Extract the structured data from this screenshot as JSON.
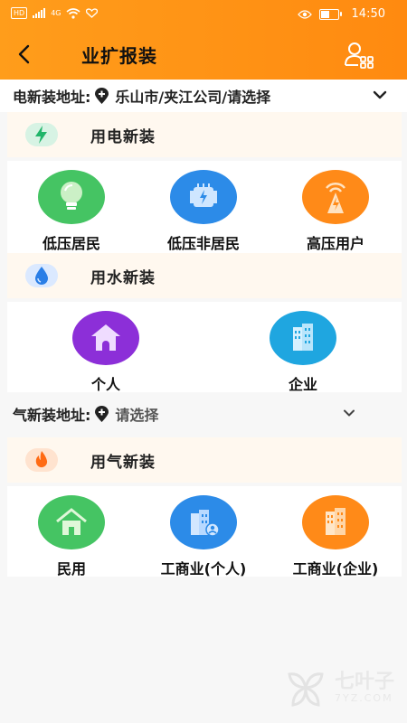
{
  "status_bar": {
    "left_chips": [
      "HD",
      "4G"
    ],
    "time": "14:50"
  },
  "header": {
    "title": "业扩报装"
  },
  "electric_address": {
    "label": "电新装地址:",
    "value": "乐山市/夹江公司/请选择"
  },
  "electric_section": {
    "title": "用电新装",
    "items": [
      {
        "label": "低压居民",
        "icon": "lightbulb-icon",
        "color": "#45c463"
      },
      {
        "label": "低压非居民",
        "icon": "transformer-icon",
        "color": "#2c8be8"
      },
      {
        "label": "高压用户",
        "icon": "tower-icon",
        "color": "#ff8a18"
      }
    ]
  },
  "water_section": {
    "title": "用水新装",
    "items": [
      {
        "label": "个人",
        "icon": "house-icon",
        "color": "#8c2fd8"
      },
      {
        "label": "企业",
        "icon": "building-icon",
        "color": "#1fa6e0"
      }
    ]
  },
  "gas_address": {
    "label": "气新装地址:",
    "value": "请选择"
  },
  "gas_section": {
    "title": "用气新装",
    "items": [
      {
        "label": "民用",
        "icon": "house-icon",
        "color": "#45c463"
      },
      {
        "label": "工商业(个人)",
        "icon": "building-person-icon",
        "color": "#2c8be8"
      },
      {
        "label": "工商业(企业)",
        "icon": "building-icon",
        "color": "#ff8a18"
      }
    ]
  },
  "watermark": {
    "name": "七叶子",
    "domain": "7YZ.COM"
  },
  "colors": {
    "header": "#ff9016",
    "section_bg": "#fff8ef"
  }
}
